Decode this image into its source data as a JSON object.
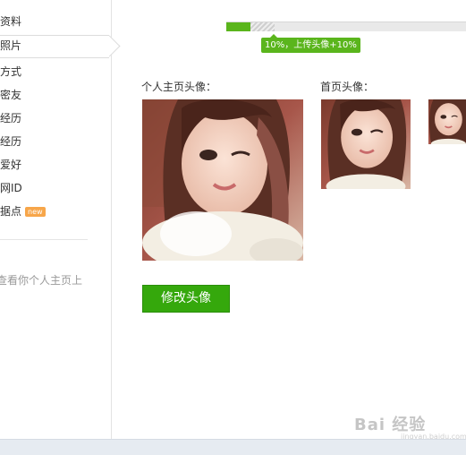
{
  "sidebar": {
    "items": [
      {
        "label": "资料"
      },
      {
        "label": "照片"
      },
      {
        "label": "方式"
      },
      {
        "label": "密友"
      },
      {
        "label": "经历"
      },
      {
        "label": "经历"
      },
      {
        "label": "爱好"
      },
      {
        "label": "网ID"
      },
      {
        "label": "据点",
        "badge": "new"
      }
    ],
    "tip": "查看你个人主页上"
  },
  "progress": {
    "percent": 10,
    "next_percent": 20,
    "tip": "10%，上传头像+10%"
  },
  "avatars": {
    "profile_title": "个人主页头像：",
    "home_title": "首页头像："
  },
  "edit_button": "修改头像",
  "watermark": {
    "text": "Bai 经验",
    "sub": "jingyan.baidu.com"
  }
}
